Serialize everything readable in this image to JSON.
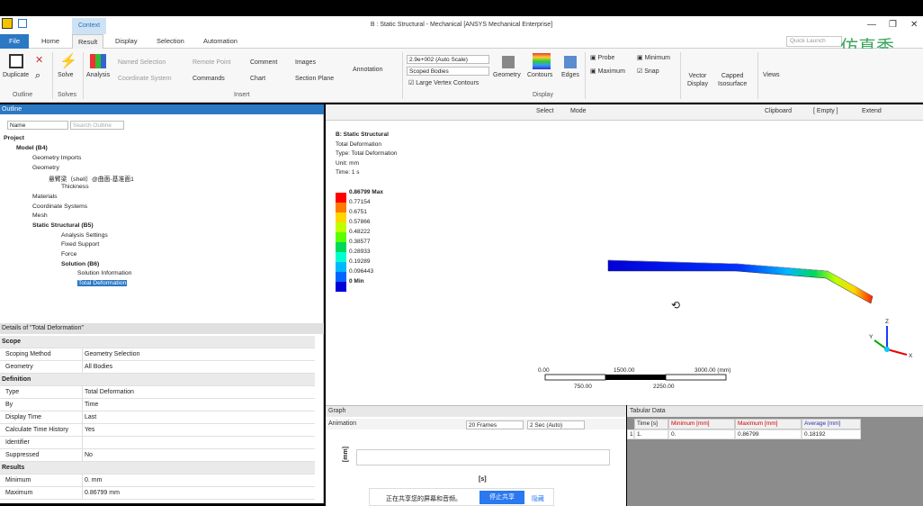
{
  "window": {
    "title": "B : Static Structural - Mechanical [ANSYS Mechanical Enterprise]",
    "context_tab": "Context"
  },
  "tabs": [
    "File",
    "Home",
    "Result",
    "Display",
    "Selection",
    "Automation"
  ],
  "quick_launch": "Quick Launch",
  "watermark": "仿真秀",
  "ribbon": {
    "duplicate": "Duplicate",
    "outline": "Outline",
    "solve": "Solve",
    "solves": "Solves",
    "analysis": "Analysis",
    "named_selection": "Named Selection",
    "coordinate_system": "Coordinate System",
    "remote_point": "Remote Point",
    "commands": "Commands",
    "comment": "Comment",
    "chart": "Chart",
    "images": "Images",
    "section_plane": "Section Plane",
    "annotation": "Annotation",
    "insert": "Insert",
    "scale": "2.9e+002 (Auto Scale)",
    "scoped_bodies": "Scoped Bodies",
    "large_vertex": "Large Vertex Contours",
    "geometry": "Geometry",
    "contours": "Contours",
    "edges": "Edges",
    "display": "Display",
    "probe": "Probe",
    "minimum": "Minimum",
    "maximum": "Maximum",
    "snap": "Snap",
    "vector_display": "Vector\nDisplay",
    "capped_isosurface": "Capped\nIsosurface",
    "views": "Views"
  },
  "outline": {
    "title": "Outline",
    "col_name": "Name",
    "search": "Search Outline",
    "items": [
      "Project",
      "Model (B4)",
      "Geometry Imports",
      "Geometry",
      "悬臂梁（shell）@曲面-基准面1",
      "Thickness",
      "Materials",
      "Coordinate Systems",
      "Mesh",
      "Static Structural (B5)",
      "Analysis Settings",
      "Fixed Support",
      "Force",
      "Solution (B6)",
      "Solution Information",
      "Total Deformation"
    ]
  },
  "details": {
    "title": "Details of \"Total Deformation\"",
    "rows": [
      {
        "k": "Scope",
        "v": "",
        "sec": true
      },
      {
        "k": "Scoping Method",
        "v": "Geometry Selection"
      },
      {
        "k": "Geometry",
        "v": "All Bodies"
      },
      {
        "k": "Definition",
        "v": "",
        "sec": true
      },
      {
        "k": "Type",
        "v": "Total Deformation"
      },
      {
        "k": "By",
        "v": "Time"
      },
      {
        "k": "Display Time",
        "v": "Last"
      },
      {
        "k": "Calculate Time History",
        "v": "Yes"
      },
      {
        "k": "Identifier",
        "v": ""
      },
      {
        "k": "Suppressed",
        "v": "No"
      },
      {
        "k": "Results",
        "v": "",
        "sec": true
      },
      {
        "k": "Minimum",
        "v": "0. mm"
      },
      {
        "k": "Maximum",
        "v": "0.86799 mm"
      }
    ]
  },
  "graphics_toolbar": {
    "select": "Select",
    "mode": "Mode",
    "clipboard": "Clipboard",
    "empty": "[ Empty ]",
    "extend": "Extend"
  },
  "viewport": {
    "title": "B: Static Structural",
    "l1": "Total Deformation",
    "l2": "Type: Total Deformation",
    "l3": "Unit: mm",
    "l4": "Time: 1 s",
    "legend": [
      "0.86799 Max",
      "0.77154",
      "0.6751",
      "0.57866",
      "0.48222",
      "0.38577",
      "0.28933",
      "0.19289",
      "0.096443",
      "0 Min"
    ],
    "legend_colors": [
      "#ff0000",
      "#ff7a00",
      "#ffd500",
      "#bfff00",
      "#5aff00",
      "#00d95a",
      "#00ffd0",
      "#00b8ff",
      "#0066ff",
      "#0000d8"
    ],
    "scale": {
      "t0": "0.00",
      "t1": "1500.00",
      "t2": "3000.00 (mm)",
      "b1": "750.00",
      "b2": "2250.00"
    },
    "axes": {
      "z": "Z",
      "y": "Y",
      "x": "X"
    }
  },
  "graph": {
    "title": "Graph",
    "animation": "Animation",
    "frames": "20 Frames",
    "sec": "2 Sec (Auto)",
    "ylabel": "[mm]",
    "xlabel": "[s]"
  },
  "tabular": {
    "title": "Tabular Data",
    "headers": [
      "Time [s]",
      "Minimum [mm]",
      "Maximum [mm]",
      "Average [mm]"
    ],
    "row": [
      "1",
      "1.",
      "0.",
      "0.86799",
      "0.18192"
    ]
  },
  "share": {
    "text": "正在共享您的屏幕和音频。",
    "stop": "停止共享",
    "hide": "隐藏"
  }
}
